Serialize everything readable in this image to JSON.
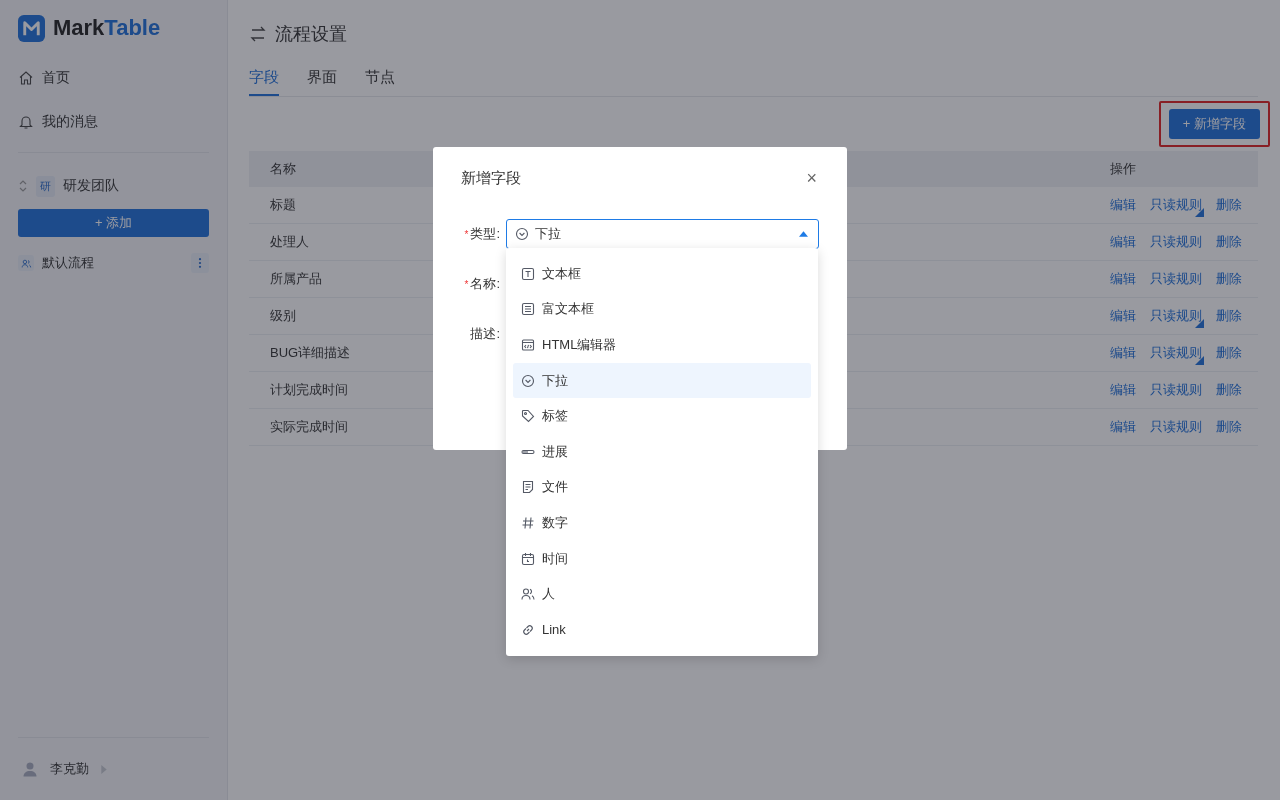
{
  "sidebar": {
    "logo": {
      "prefix": "Mark",
      "suffix": "Table"
    },
    "nav": [
      {
        "kind": "home",
        "label": "首页"
      },
      {
        "kind": "bell",
        "label": "我的消息"
      }
    ],
    "team": {
      "badge": "研",
      "name": "研发团队"
    },
    "add_button": "+ 添加",
    "flows": [
      {
        "label": "默认流程"
      }
    ],
    "user": {
      "name": "李克勤"
    }
  },
  "page": {
    "title": "流程设置",
    "tabs": [
      {
        "label": "字段",
        "selected": true
      },
      {
        "label": "界面",
        "selected": false
      },
      {
        "label": "节点",
        "selected": false
      }
    ],
    "new_button": {
      "label": "+ 新增字段",
      "highlighted": true
    },
    "table": {
      "columns": [
        "名称",
        "操作"
      ],
      "rows": [
        {
          "name": "标题",
          "actions": [
            "编辑",
            "只读规则",
            "删除"
          ],
          "rule_flag": true
        },
        {
          "name": "处理人",
          "actions": [
            "编辑",
            "只读规则",
            "删除"
          ],
          "rule_flag": false
        },
        {
          "name": "所属产品",
          "actions": [
            "编辑",
            "只读规则",
            "删除"
          ],
          "rule_flag": false
        },
        {
          "name": "级别",
          "actions": [
            "编辑",
            "只读规则",
            "删除"
          ],
          "rule_flag": true
        },
        {
          "name": "BUG详细描述",
          "actions": [
            "编辑",
            "只读规则",
            "删除"
          ],
          "rule_flag": true
        },
        {
          "name": "计划完成时间",
          "actions": [
            "编辑",
            "只读规则",
            "删除"
          ],
          "rule_flag": false
        },
        {
          "name": "实际完成时间",
          "actions": [
            "编辑",
            "只读规则",
            "删除"
          ],
          "rule_flag": false
        }
      ]
    }
  },
  "dialog": {
    "title": "新增字段",
    "close": "×",
    "fields": [
      {
        "label": "类型:",
        "required_mark": "*"
      },
      {
        "label": "名称:",
        "required_mark": "*"
      },
      {
        "label": "描述:"
      }
    ],
    "type_select": {
      "value": "下拉",
      "kind": "select",
      "expanded": true
    },
    "options": [
      {
        "kind": "text",
        "label": "文本框",
        "selected": false
      },
      {
        "kind": "rich",
        "label": "富文本框",
        "selected": false
      },
      {
        "kind": "html",
        "label": "HTML编辑器",
        "selected": false
      },
      {
        "kind": "select",
        "label": "下拉",
        "selected": true
      },
      {
        "kind": "tag",
        "label": "标签",
        "selected": false
      },
      {
        "kind": "progress",
        "label": "进展",
        "selected": false
      },
      {
        "kind": "file",
        "label": "文件",
        "selected": false
      },
      {
        "kind": "number",
        "label": "数字",
        "selected": false
      },
      {
        "kind": "time",
        "label": "时间",
        "selected": false
      },
      {
        "kind": "person",
        "label": "人",
        "selected": false
      },
      {
        "kind": "link",
        "label": "Link",
        "selected": false
      }
    ]
  }
}
